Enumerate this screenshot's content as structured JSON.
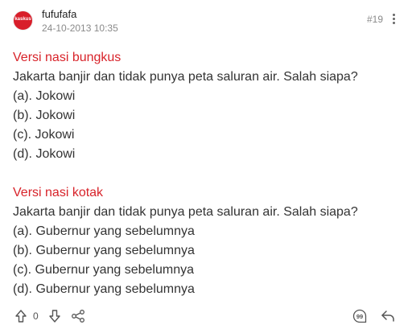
{
  "post": {
    "username": "fufufafa",
    "timestamp": "24-10-2013 10:35",
    "post_number": "#19",
    "avatar_text": "kaskus"
  },
  "sections": [
    {
      "title": "Versi nasi bungkus",
      "lines": [
        "Jakarta banjir dan tidak punya peta saluran air. Salah siapa?",
        "(a). Jokowi",
        "(b). Jokowi",
        "(c). Jokowi",
        "(d). Jokowi"
      ]
    },
    {
      "title": "Versi nasi kotak",
      "lines": [
        "Jakarta banjir dan tidak punya peta saluran air. Salah siapa?",
        "(a). Gubernur yang sebelumnya",
        "(b). Gubernur yang sebelumnya",
        "(c). Gubernur yang sebelumnya",
        "(d). Gubernur yang sebelumnya"
      ]
    }
  ],
  "footer": {
    "vote_count": "0",
    "icons": {
      "upvote": "arrow-up-icon",
      "downvote": "arrow-down-icon",
      "share": "share-icon",
      "quote": "quote-icon",
      "reply": "reply-icon"
    }
  },
  "colors": {
    "accent": "#d8232a",
    "muted": "#8a8a8a",
    "text": "#333333"
  }
}
